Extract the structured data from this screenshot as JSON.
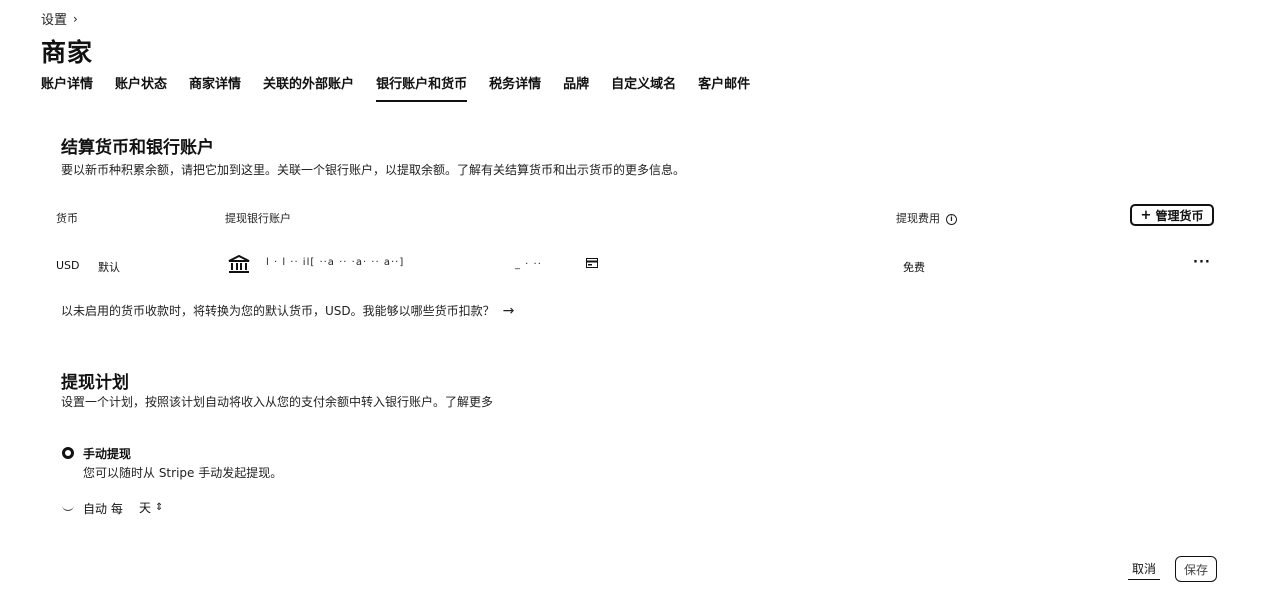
{
  "breadcrumb": {
    "label": "设置",
    "chevron": "›"
  },
  "page": {
    "title": "商家"
  },
  "tabs": [
    {
      "label": "账户详情"
    },
    {
      "label": "账户状态"
    },
    {
      "label": "商家详情"
    },
    {
      "label": "关联的外部账户"
    },
    {
      "label": "银行账户和货币",
      "active": true
    },
    {
      "label": "税务详情"
    },
    {
      "label": "品牌"
    },
    {
      "label": "自定义域名"
    },
    {
      "label": "客户邮件"
    }
  ],
  "settlement": {
    "title": "结算货币和银行账户",
    "description": "要以新币种积累余额，请把它加到这里。关联一个银行账户，以提取余额。了解有关结算货币和出示货币的更多信息。",
    "columns": {
      "currency": "货币",
      "bank_account": "提现银行账户",
      "payout_fee": "提现费用"
    },
    "manage_button": "管理货币",
    "rows": [
      {
        "currency": "USD",
        "badge": "默认",
        "bank_mask_a": "l · l ·· il[ ··a ·· ·a· ·· a··]",
        "bank_mask_b": "_ · ··",
        "fee": "免费"
      }
    ],
    "note": "以未启用的货币收款时，将转换为您的默认货币，USD。我能够以哪些货币扣款？"
  },
  "payout_schedule": {
    "title": "提现计划",
    "description": "设置一个计划，按照该计划自动将收入从您的支付余额中转入银行账户。了解更多",
    "manual": {
      "label": "手动提现",
      "sublabel": "您可以随时从 Stripe 手动发起提现。",
      "selected": true
    },
    "auto": {
      "label": "自动 每",
      "interval_value": "天",
      "selected": false
    }
  },
  "footer": {
    "cancel": "取消",
    "save": "保存"
  },
  "colors": {
    "text": "#111111",
    "background": "#ffffff"
  }
}
